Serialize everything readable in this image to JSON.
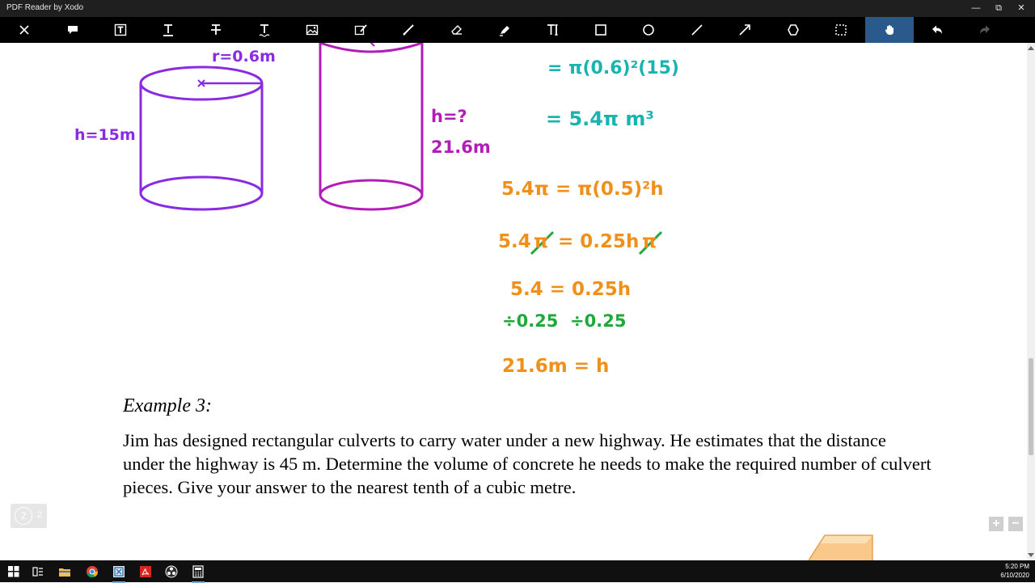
{
  "app": {
    "title": "PDF Reader by Xodo",
    "window_buttons": {
      "minimize": "—",
      "restore": "⧉",
      "close": "✕"
    }
  },
  "toolbar": {
    "tools": [
      {
        "name": "close-tool",
        "icon": "close-icon"
      },
      {
        "name": "comment-tool",
        "icon": "comment-icon"
      },
      {
        "name": "free-text-tool",
        "icon": "text-box-icon"
      },
      {
        "name": "underline-tool",
        "icon": "underline-icon"
      },
      {
        "name": "strikeout-tool",
        "icon": "strikeout-icon"
      },
      {
        "name": "squiggly-tool",
        "icon": "squiggly-icon"
      },
      {
        "name": "image-tool",
        "icon": "image-icon"
      },
      {
        "name": "signature-tool",
        "icon": "signature-icon"
      },
      {
        "name": "pen-tool",
        "icon": "pen-icon"
      },
      {
        "name": "eraser-tool",
        "icon": "eraser-icon"
      },
      {
        "name": "highlighter-tool",
        "icon": "highlighter-icon"
      },
      {
        "name": "text-tool",
        "icon": "text-cursor-icon"
      },
      {
        "name": "rectangle-tool",
        "icon": "rectangle-icon"
      },
      {
        "name": "ellipse-tool",
        "icon": "ellipse-icon"
      },
      {
        "name": "line-tool",
        "icon": "line-icon"
      },
      {
        "name": "arrow-tool",
        "icon": "arrow-icon"
      },
      {
        "name": "polygon-tool",
        "icon": "polygon-icon"
      },
      {
        "name": "select-tool",
        "icon": "dashed-rectangle-icon"
      },
      {
        "name": "pan-tool",
        "icon": "hand-icon",
        "active": true
      },
      {
        "name": "undo-tool",
        "icon": "undo-icon"
      },
      {
        "name": "redo-tool",
        "icon": "redo-icon"
      }
    ],
    "active_color": "#2a5a8c"
  },
  "handwriting": {
    "radius_label": "r=0.6m",
    "height1_label": "h=15m",
    "height2_label": "h=?",
    "height2_answer": "21.6m",
    "teal_line1": "= π(0.6)²(15)",
    "teal_line2": "= 5.4π m³",
    "orange_line1": "5.4π = π(0.5)²h",
    "orange_line2_left": "5.4",
    "orange_line2_pi1": "π",
    "orange_line2_mid": "= 0.25h",
    "orange_line2_pi2": "π",
    "orange_line3": "5.4 = 0.25h",
    "green_line": "÷0.25  ÷0.25",
    "orange_answer": "21.6m = h"
  },
  "colors": {
    "cyl1": "#8a2be2",
    "cyl2": "#b21cb8",
    "teal": "#19b3b0",
    "orange": "#f0901a",
    "green": "#21a83a"
  },
  "document": {
    "example_title": "Example 3:",
    "problem": "Jim has designed rectangular culverts to carry water under a new highway.  He estimates that the distance under the highway is 45 m. Determine the volume of concrete he needs to make the required number of culvert pieces. Give your answer to the nearest tenth of a cubic metre."
  },
  "page_indicator": {
    "current": "2",
    "total": "2"
  },
  "zoom": {
    "in": "+",
    "out": "−"
  },
  "taskbar": {
    "items": [
      "windows-start-icon",
      "task-view-icon",
      "file-explorer-icon",
      "chrome-icon",
      "xodo-icon",
      "acrobat-icon",
      "obs-icon",
      "calculator-icon"
    ],
    "time": "5:20 PM",
    "date": "6/10/2020"
  }
}
